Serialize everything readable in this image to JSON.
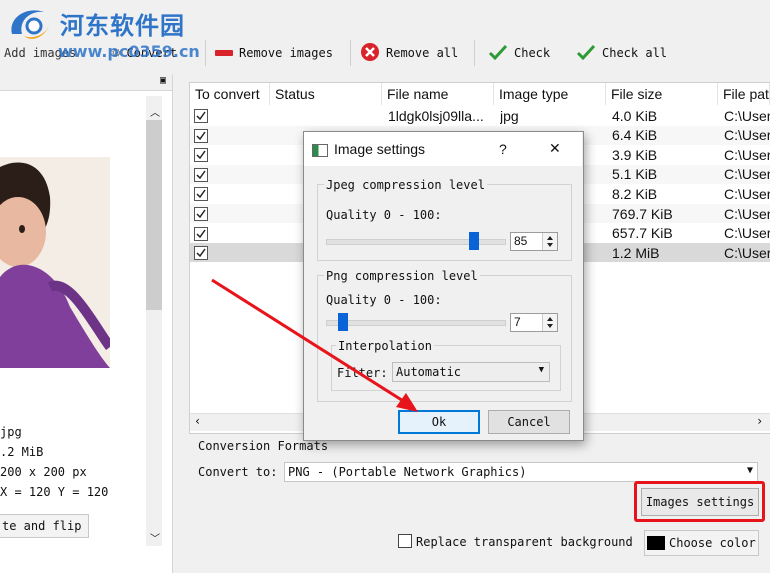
{
  "watermark": {
    "title": "河东软件园",
    "url": "www.pc0359.cn"
  },
  "toolbar": {
    "add_images": "Add images",
    "convert": "Convert",
    "remove_images": "Remove images",
    "remove_all": "Remove all",
    "check": "Check",
    "check_all": "Check all"
  },
  "left_panel": {
    "info": {
      "type": "jpg",
      "size": ".2 MiB",
      "dimensions": "200 x 200 px",
      "coords": "X = 120 Y = 120"
    },
    "rotate_button": "te and flip"
  },
  "table": {
    "columns": [
      "To convert",
      "Status",
      "File name",
      "Image type",
      "File size",
      "File pat"
    ],
    "rows": [
      {
        "checked": true,
        "status": "",
        "name": "1ldgk0lsj09lla...",
        "type": "jpg",
        "size": "4.0 KiB",
        "path": "C:\\User"
      },
      {
        "checked": true,
        "status": "",
        "name": "",
        "type": "",
        "size": "6.4 KiB",
        "path": "C:\\User"
      },
      {
        "checked": true,
        "status": "",
        "name": "",
        "type": "",
        "size": "3.9 KiB",
        "path": "C:\\User"
      },
      {
        "checked": true,
        "status": "",
        "name": "",
        "type": "",
        "size": "5.1 KiB",
        "path": "C:\\User"
      },
      {
        "checked": true,
        "status": "",
        "name": "",
        "type": "",
        "size": "8.2 KiB",
        "path": "C:\\User"
      },
      {
        "checked": true,
        "status": "",
        "name": "",
        "type": "",
        "size": "769.7 KiB",
        "path": "C:\\User"
      },
      {
        "checked": true,
        "status": "",
        "name": "",
        "type": "",
        "size": "657.7 KiB",
        "path": "C:\\User"
      },
      {
        "checked": true,
        "status": "",
        "name": "",
        "type": "",
        "size": "1.2 MiB",
        "path": "C:\\User"
      }
    ]
  },
  "conversion": {
    "group_label": "Conversion Formats",
    "convert_to_label": "Convert to:",
    "convert_to_value": "PNG - (Portable Network Graphics)",
    "images_settings": "Images settings",
    "replace_bg": "Replace transparent background",
    "choose_color": "Choose color"
  },
  "dialog": {
    "title": "Image settings",
    "help": "?",
    "close": "✕",
    "jpeg_group": "Jpeg compression level",
    "jpeg_quality_label": "Quality 0 - 100:",
    "jpeg_quality": "85",
    "png_group": "Png compression level",
    "png_quality_label": "Quality 0 - 100:",
    "png_quality": "7",
    "interp_group": "Interpolation",
    "filter_label": "Filter:",
    "filter_value": "Automatic",
    "ok": "Ok",
    "cancel": "Cancel"
  },
  "colors": {
    "accent": "#0078d7",
    "highlight": "#e8141b",
    "watermark": "#2e74c9"
  }
}
